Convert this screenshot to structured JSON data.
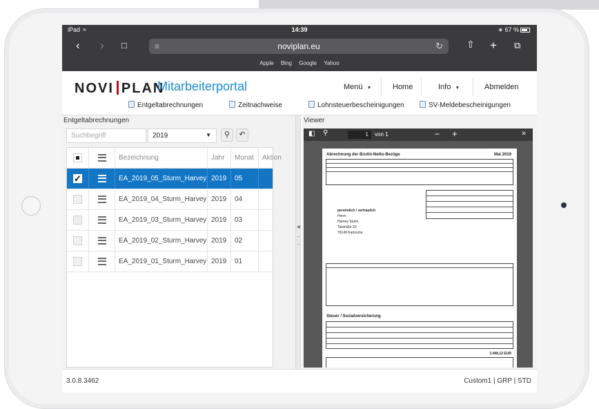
{
  "status_bar": {
    "device": "iPad",
    "time": "14:39",
    "battery": "67 %"
  },
  "browser": {
    "url": "noviplan.eu",
    "bookmarks": [
      "Apple",
      "Bing",
      "Google",
      "Yahoo"
    ],
    "icons": [
      "back-icon",
      "forward-icon",
      "bookmarks-icon",
      "reader-icon",
      "reload-icon",
      "share-icon",
      "new-tab-icon",
      "tabs-icon"
    ]
  },
  "app": {
    "logo_left": "NOVI",
    "logo_right": "PLAN",
    "title": "Mitarbeiterportal",
    "nav": {
      "menu": "Menü",
      "home": "Home",
      "info": "Info",
      "logout": "Abmelden"
    },
    "subnav": [
      "Entgeltabrechnungen",
      "Zeitnachweise",
      "Lohnsteuerbescheinigungen",
      "SV-Meldebescheinigungen"
    ],
    "accent": "#1b8bd2",
    "brand_red": "#c00d11"
  },
  "list": {
    "title": "Entgeltabrechnungen",
    "search_placeholder": "Suchbegriff",
    "year": "2019",
    "columns": [
      "Bezeichnung",
      "Jahr",
      "Monat",
      "Aktion"
    ],
    "rows": [
      {
        "name": "EA_2019_05_Sturm_Harvey",
        "year": "2019",
        "month": "05",
        "selected": true
      },
      {
        "name": "EA_2019_04_Sturm_Harvey",
        "year": "2019",
        "month": "04",
        "selected": false
      },
      {
        "name": "EA_2019_03_Sturm_Harvey",
        "year": "2019",
        "month": "03",
        "selected": false
      },
      {
        "name": "EA_2019_02_Sturm_Harvey",
        "year": "2019",
        "month": "02",
        "selected": false
      },
      {
        "name": "EA_2019_01_Sturm_Harvey",
        "year": "2019",
        "month": "01",
        "selected": false
      }
    ],
    "selected_color": "#1376c5"
  },
  "viewer": {
    "title": "Viewer",
    "page": "1",
    "page_of": "von 1",
    "document": {
      "heading": "Abrechnung der Brutto-Netto-Bezüge",
      "month": "Mai 2019",
      "address_lines": [
        "persönlich / vertraulich",
        "Herrn",
        "Harvey Sturm",
        "Talstraße 20",
        "76149 Karlsruhe"
      ],
      "tax_section": "Steuer / Sozialversicherung",
      "net_total": "2.408,12 EUR"
    }
  },
  "footer": {
    "version": "3.0.8.3462",
    "info": "Custom1 | GRP | STD"
  }
}
